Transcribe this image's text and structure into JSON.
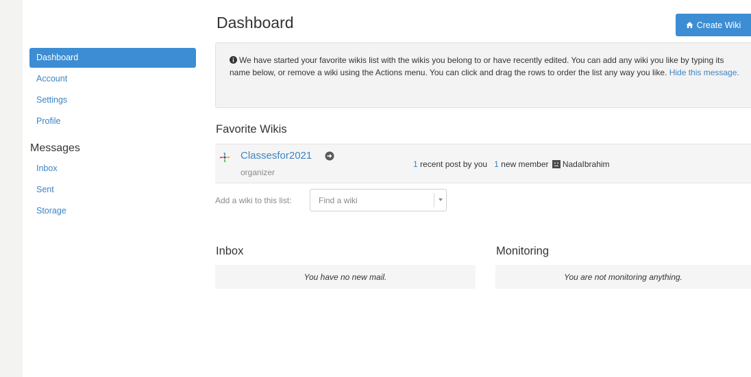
{
  "sidebar": {
    "items": [
      {
        "label": "Dashboard",
        "active": true
      },
      {
        "label": "Account"
      },
      {
        "label": "Settings"
      },
      {
        "label": "Profile"
      }
    ],
    "messages_heading": "Messages",
    "message_items": [
      {
        "label": "Inbox"
      },
      {
        "label": "Sent"
      },
      {
        "label": "Storage"
      }
    ]
  },
  "header": {
    "title": "Dashboard",
    "create_button": "Create Wiki",
    "create_icon": "home-icon"
  },
  "notice": {
    "icon": "info-circle-icon",
    "text": "We have started your favorite wikis list with the wikis you belong to or have recently edited. You can add any wiki you like by typing its name below, or remove a wiki using the Actions menu. You can click and drag the rows to order the list any way you like.",
    "hide_link": "Hide this message."
  },
  "favorites": {
    "title": "Favorite Wikis",
    "wikis": [
      {
        "name": "Classesfor2021",
        "role": "organizer",
        "recent_posts_count": "1",
        "recent_posts_text": "recent post by you",
        "new_members_count": "1",
        "new_members_text": "new member",
        "member_name": "NadaIbrahim"
      }
    ],
    "add_label": "Add a wiki to this list:",
    "find_placeholder": "Find a wiki"
  },
  "inbox": {
    "title": "Inbox",
    "empty_text": "You have no new mail."
  },
  "monitoring": {
    "title": "Monitoring",
    "empty_text": "You are not monitoring anything."
  },
  "colors": {
    "accent": "#3c8dd3",
    "link": "#3b84c4"
  }
}
